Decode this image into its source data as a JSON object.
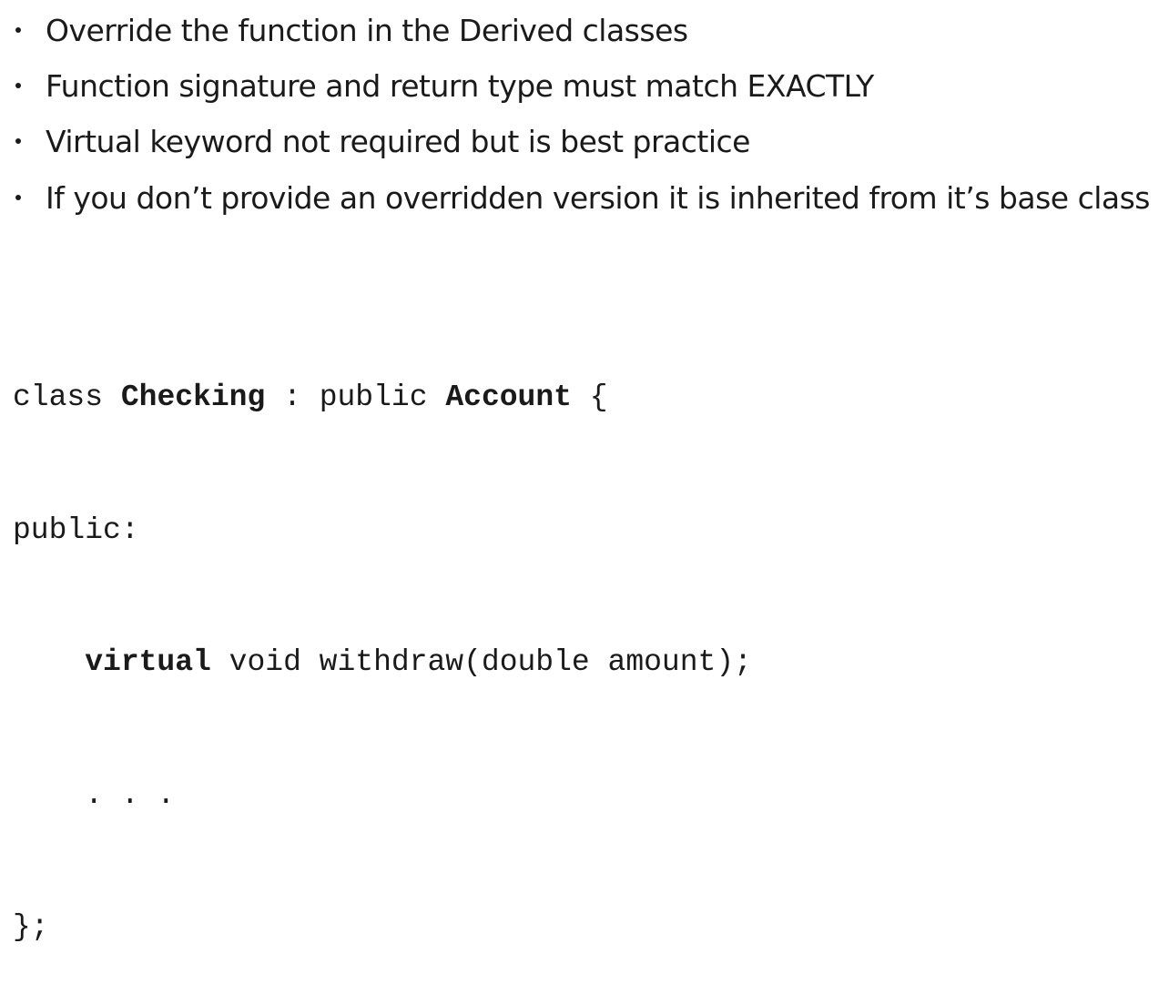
{
  "bullets": [
    "Override the function in the Derived classes",
    "Function signature and return type must match EXACTLY",
    "Virtual keyword not required but is best practice",
    "If you don’t provide an overridden version it is inherited from it’s base class"
  ],
  "code": {
    "line1": {
      "kw_class": "class",
      "class_name": "Checking",
      "colon_public": ": public",
      "base_name": "Account",
      "brace_open": "{"
    },
    "line2": "public:",
    "line3": {
      "kw_virtual": "virtual",
      "signature": "void withdraw(double amount);"
    },
    "line4": ". . .",
    "line5": "};"
  }
}
